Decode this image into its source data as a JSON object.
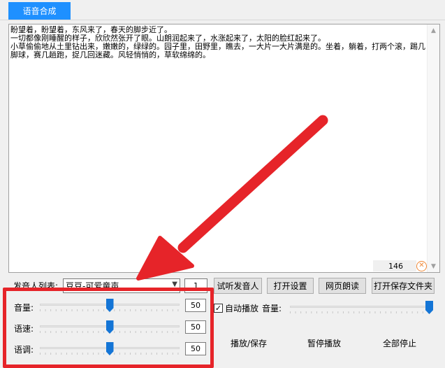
{
  "tabs": [
    {
      "label": "语音合成",
      "active": true
    }
  ],
  "text_area": {
    "content": "盼望着，盼望着，东风来了，春天的脚步近了。\n一切都像刚睡醒的样子，欣欣然张开了眼。山朗润起来了，水涨起来了，太阳的脸红起来了。\n小草偷偷地从土里钻出来，嫩嫩的，绿绿的。园子里，田野里，瞧去，一大片一大片满是的。坐着，躺着，打两个滚，踢几脚球，赛几趟跑，捉几回迷藏。风轻悄悄的，草软绵绵的。",
    "char_count": "146"
  },
  "voice": {
    "label": "发音人列表:",
    "selected": "豆豆-可爱童声",
    "count": "1"
  },
  "buttons": {
    "trial": "试听发音人",
    "open_settings": "打开设置",
    "web_read": "网页朗读",
    "open_save_folder": "打开保存文件夹"
  },
  "sliders": [
    {
      "id": "volume",
      "label": "音量:",
      "value": "50",
      "fraction": 0.5
    },
    {
      "id": "speed",
      "label": "语速:",
      "value": "50",
      "fraction": 0.5
    },
    {
      "id": "pitch",
      "label": "语调:",
      "value": "50",
      "fraction": 0.5
    }
  ],
  "autoplay": {
    "label": "自动播放",
    "checked": true,
    "volume_label": "音量:",
    "volume_fraction": 1.0
  },
  "actions": {
    "play_save": "播放/保存",
    "pause": "暂停播放",
    "stop_all": "全部停止"
  },
  "colors": {
    "accent": "#1e90ff",
    "slider_thumb": "#1475d6",
    "highlight": "#e62429"
  }
}
